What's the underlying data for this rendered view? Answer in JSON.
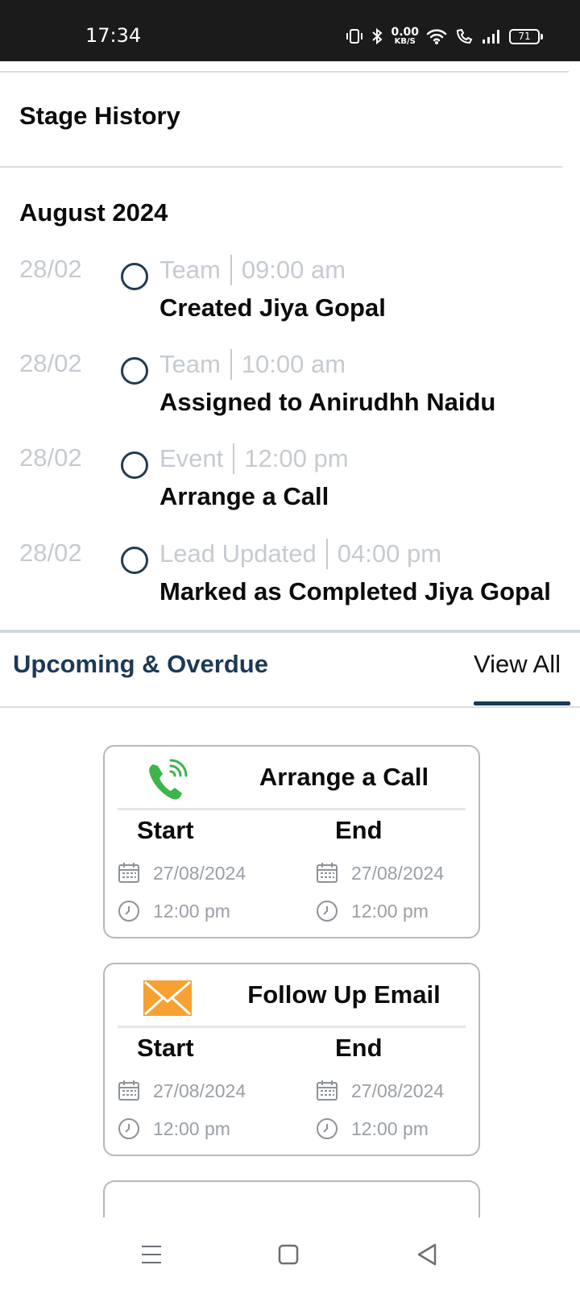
{
  "status_bar": {
    "time": "17:34",
    "net_speed_value": "0.00",
    "net_speed_unit": "KB/S",
    "battery": "71"
  },
  "stage_history": {
    "title": "Stage History",
    "month": "August 2024",
    "entries": [
      {
        "date": "28/02",
        "type": "Team",
        "time": "09:00 am",
        "description": "Created Jiya Gopal"
      },
      {
        "date": "28/02",
        "type": "Team",
        "time": "10:00 am",
        "description": "Assigned to Anirudhh Naidu"
      },
      {
        "date": "28/02",
        "type": "Event",
        "time": "12:00 pm",
        "description": "Arrange a Call"
      },
      {
        "date": "28/02",
        "type": "Lead Updated",
        "time": "04:00 pm",
        "description": "Marked as Completed Jiya Gopal"
      }
    ]
  },
  "upcoming": {
    "title": "Upcoming & Overdue",
    "view_all": "View All",
    "cards": [
      {
        "icon": "phone-call-icon",
        "title": "Arrange a Call",
        "start_label": "Start",
        "end_label": "End",
        "start_date": "27/08/2024",
        "end_date": "27/08/2024",
        "start_time": "12:00 pm",
        "end_time": "12:00 pm"
      },
      {
        "icon": "email-icon",
        "title": "Follow Up Email",
        "start_label": "Start",
        "end_label": "End",
        "start_date": "27/08/2024",
        "end_date": "27/08/2024",
        "start_time": "12:00 pm",
        "end_time": "12:00 pm"
      }
    ]
  },
  "colors": {
    "accent": "#1c3a57",
    "muted_text": "#c6cbd1",
    "phone_green": "#3cb54a",
    "email_orange": "#f7a133"
  }
}
